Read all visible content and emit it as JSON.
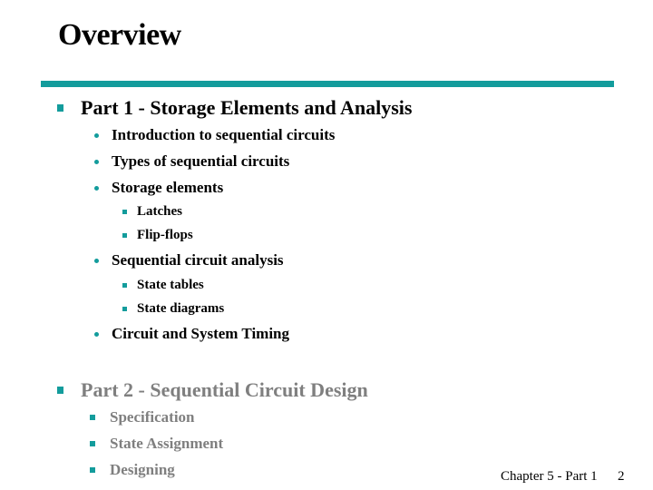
{
  "slide": {
    "title": "Overview",
    "part1": {
      "heading": "Part 1 - Storage Elements and Analysis",
      "items": [
        {
          "label": "Introduction to sequential circuits"
        },
        {
          "label": "Types of sequential circuits"
        },
        {
          "label": "Storage elements",
          "subitems": [
            "Latches",
            "Flip-flops"
          ]
        },
        {
          "label": "Sequential circuit analysis",
          "subitems": [
            "State tables",
            "State diagrams"
          ]
        },
        {
          "label": "Circuit and System Timing"
        }
      ]
    },
    "part2": {
      "heading": "Part 2 - Sequential Circuit Design",
      "items": [
        "Specification",
        "State Assignment",
        "Designing"
      ]
    },
    "footer": {
      "chapter": "Chapter 5 - Part 1",
      "page": "2"
    },
    "colors": {
      "accent": "#139c9c",
      "dimmed_text": "#7f7f7f"
    }
  }
}
